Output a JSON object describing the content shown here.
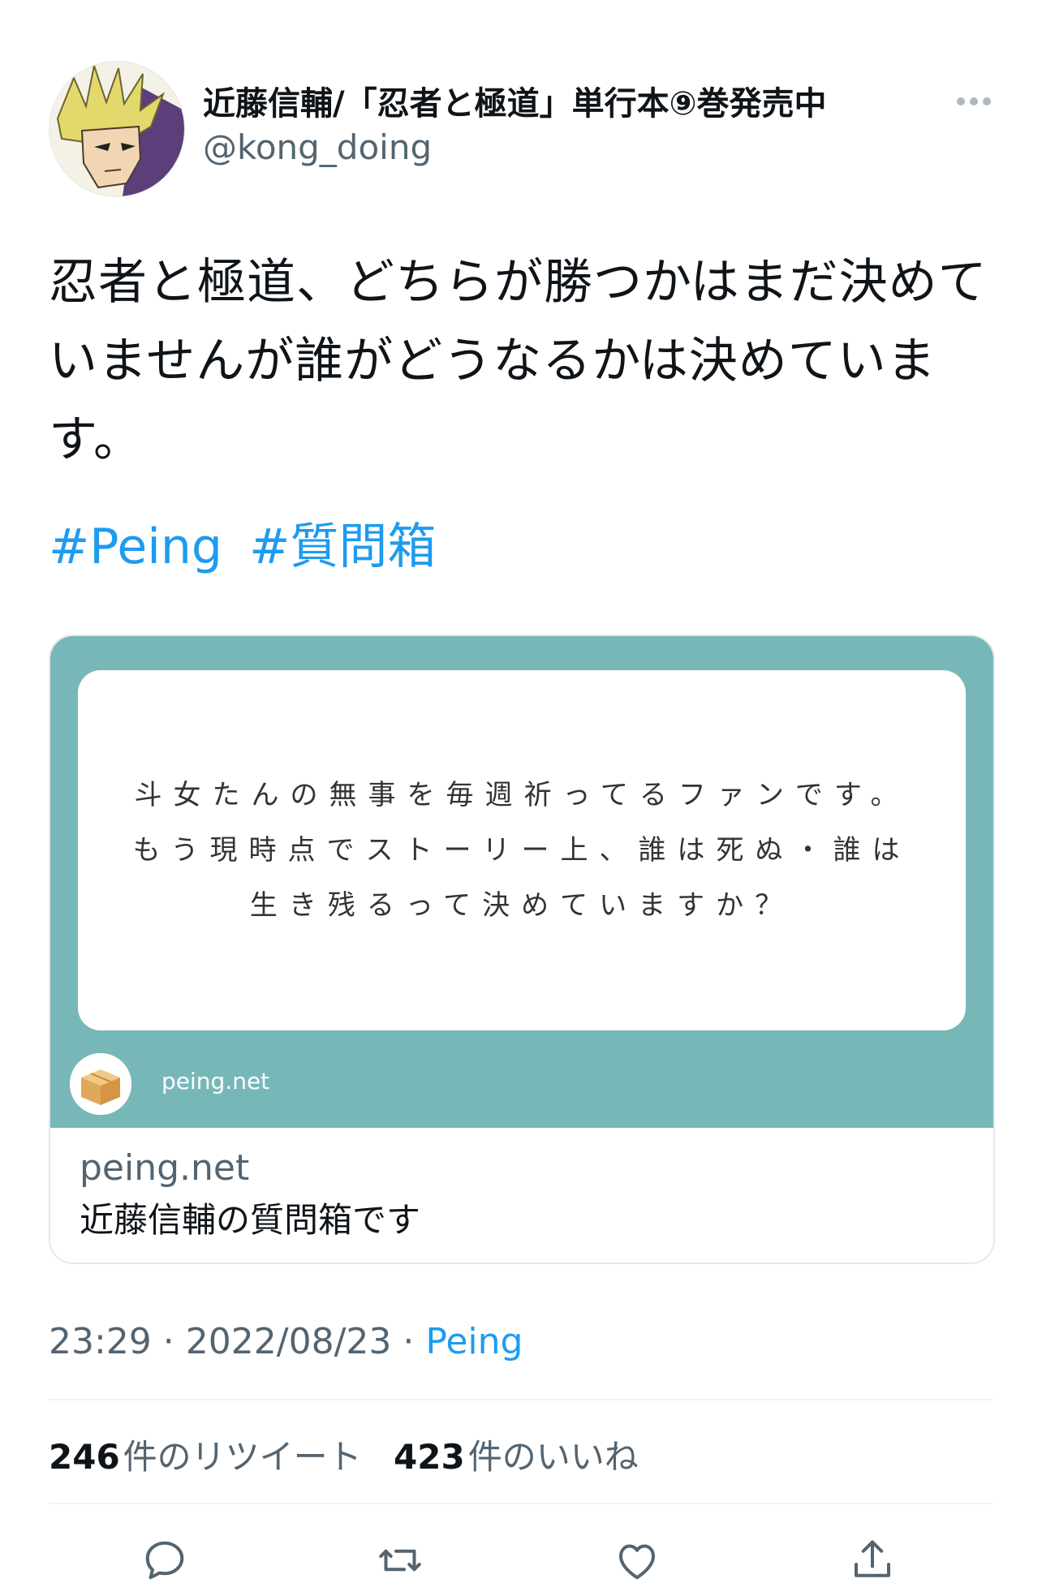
{
  "author": {
    "display_name": "近藤信輔/「忍者と極道」単行本⑨巻発売中",
    "username": "@kong_doing"
  },
  "tweet": {
    "text": "忍者と極道、どちらが勝つかはまだ決めていませんが誰がどうなるかは決めています。",
    "hashtags": [
      "#Peing",
      "#質問箱"
    ]
  },
  "card": {
    "question": "斗女たんの無事を毎週祈ってるファンです。もう現時点でストーリー上、誰は死ぬ・誰は生き残るって決めていますか？",
    "logo_label": "peing.net",
    "domain": "peing.net",
    "title": "近藤信輔の質問箱です",
    "background_color": "#78b7b8"
  },
  "meta": {
    "time": "23:29",
    "separator": " · ",
    "date": "2022/08/23",
    "source": "Peing"
  },
  "stats": {
    "retweets_count": "246",
    "retweets_label": "件のリツイート",
    "likes_count": "423",
    "likes_label": "件のいいね"
  },
  "actions": {
    "icons": [
      "reply-icon",
      "retweet-icon",
      "like-icon",
      "share-icon"
    ]
  },
  "colors": {
    "link": "#1d9bf0",
    "secondary_text": "#536471",
    "primary_text": "#0f1419"
  }
}
